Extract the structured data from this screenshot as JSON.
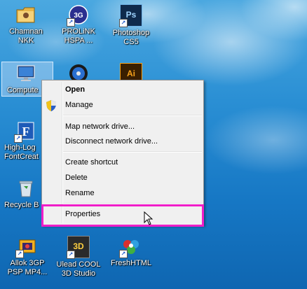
{
  "desktop_icons": [
    {
      "key": "chamnan",
      "label_line1": "Chamnan",
      "label_line2": "NKK"
    },
    {
      "key": "prolink",
      "label_line1": "PROLiNK",
      "label_line2": "HSPA ..."
    },
    {
      "key": "photoshop",
      "label_line1": "Photoshop",
      "label_line2": "CS5",
      "glyph": "Ps"
    },
    {
      "key": "computer",
      "label_line1": "Compute"
    },
    {
      "key": "illustrator",
      "glyph": "Ai"
    },
    {
      "key": "highlogic",
      "label_line1": "High-Log",
      "label_line2": "FontCreat"
    },
    {
      "key": "recycle",
      "label_line1": "Recycle B"
    },
    {
      "key": "allok",
      "label_line1": "Allok 3GP",
      "label_line2": "PSP MP4..."
    },
    {
      "key": "ulead",
      "label_line1": "Ulead COOL",
      "label_line2": "3D Studio",
      "glyph": "3D"
    },
    {
      "key": "freshhtml",
      "label_line1": "FreshHTML"
    }
  ],
  "context_menu": {
    "open": "Open",
    "manage": "Manage",
    "map_network_drive": "Map network drive...",
    "disconnect_network_drive": "Disconnect network drive...",
    "create_shortcut": "Create shortcut",
    "delete": "Delete",
    "rename": "Rename",
    "properties": "Properties"
  },
  "colors": {
    "highlight_border": "#ef1ec8",
    "desktop_blue": "#1677c4",
    "menu_bg": "#f0f0f0"
  }
}
